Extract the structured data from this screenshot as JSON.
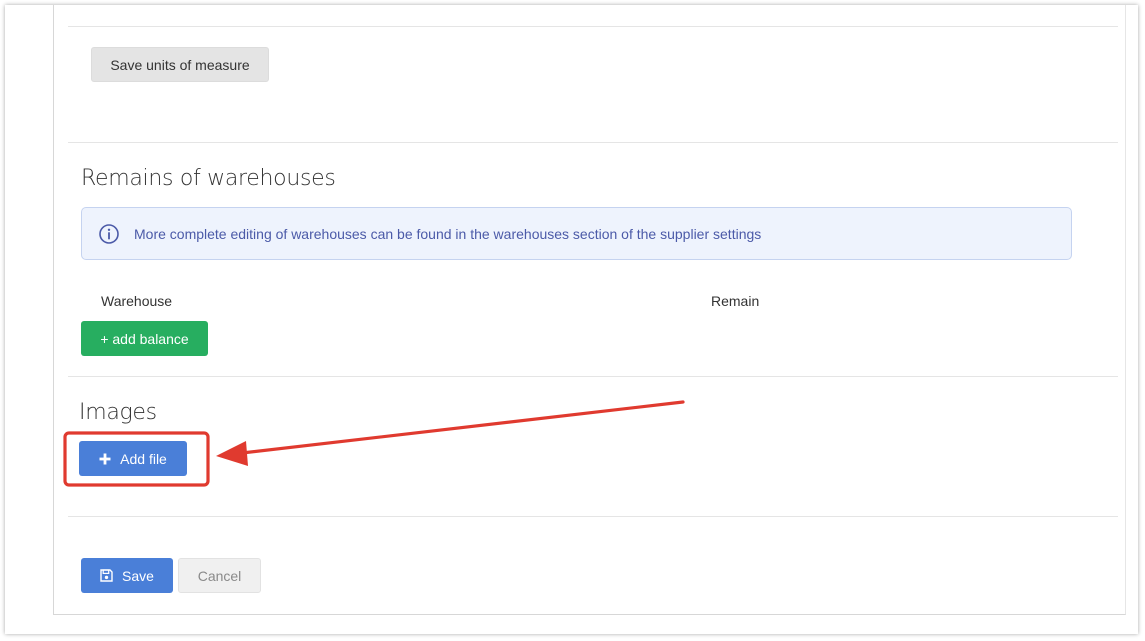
{
  "units": {
    "save_button": "Save units of measure"
  },
  "warehouses": {
    "heading": "Remains of warehouses",
    "notice": "More complete editing of warehouses can be found in the warehouses section of the supplier settings",
    "columns": [
      "Warehouse",
      "Remain"
    ],
    "add_balance_button": "+ add balance"
  },
  "images": {
    "heading": "Images",
    "add_file_button": "Add file"
  },
  "footer": {
    "save_button": "Save",
    "cancel_button": "Cancel"
  },
  "colors": {
    "accent_blue": "#4a7fd8",
    "success_green": "#27ae60",
    "annotation_red": "#e03a2f"
  },
  "annotation": {
    "highlight": "red-rectangle-around-add-file",
    "pointer": "red-arrow"
  }
}
